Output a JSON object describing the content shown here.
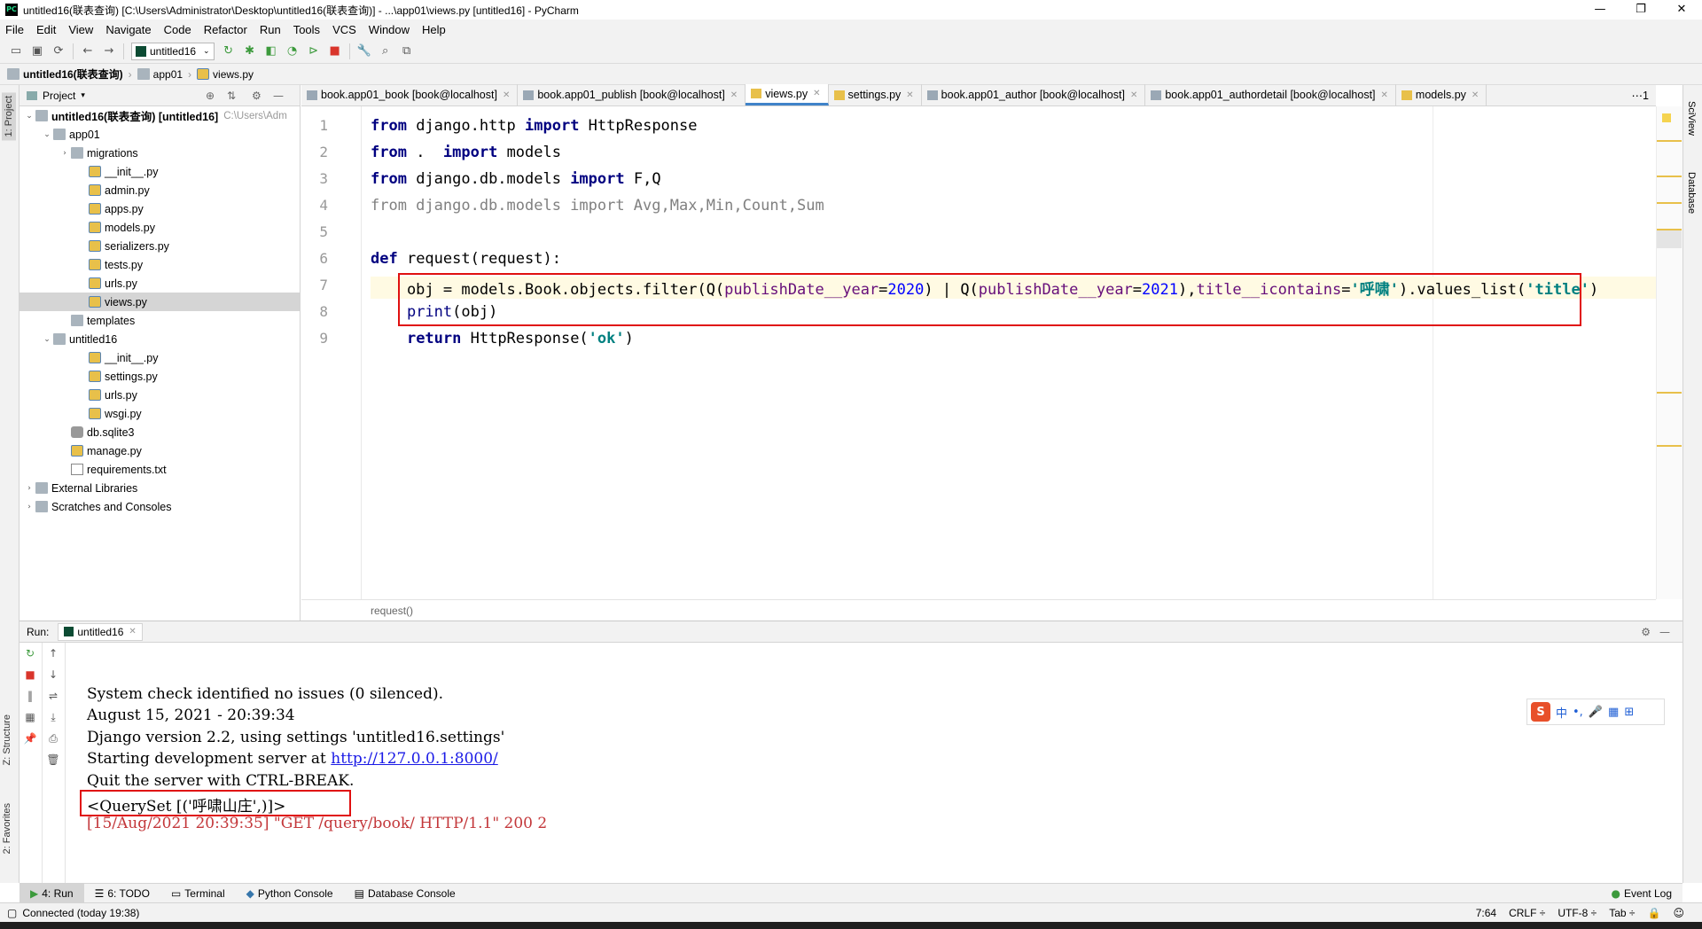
{
  "window": {
    "title": "untitled16(联表查询) [C:\\Users\\Administrator\\Desktop\\untitled16(联表查询)] - ...\\app01\\views.py [untitled16] - PyCharm",
    "logo": "PC",
    "min": "—",
    "max": "❐",
    "close": "✕"
  },
  "menu": [
    "File",
    "Edit",
    "View",
    "Navigate",
    "Code",
    "Refactor",
    "Run",
    "Tools",
    "VCS",
    "Window",
    "Help"
  ],
  "toolbar": {
    "run_config": "untitled16"
  },
  "navbar": {
    "project": "untitled16(联表查询)",
    "folder": "app01",
    "file": "views.py"
  },
  "left_strip": {
    "project": "1: Project",
    "structure": "Z: Structure",
    "favorites": "2: Favorites"
  },
  "right_strip": {
    "sciview": "SciView",
    "database": "Database"
  },
  "project_panel": {
    "title": "Project",
    "tree": [
      {
        "label": "untitled16(联表查询) [untitled16]",
        "extra": "C:\\Users\\Adm",
        "indent": 0,
        "arrow": "⌄",
        "icon": "folder",
        "bold": true
      },
      {
        "label": "app01",
        "indent": 1,
        "arrow": "⌄",
        "icon": "folder"
      },
      {
        "label": "migrations",
        "indent": 2,
        "arrow": "›",
        "icon": "folder"
      },
      {
        "label": "__init__.py",
        "indent": 3,
        "arrow": "",
        "icon": "py"
      },
      {
        "label": "admin.py",
        "indent": 3,
        "arrow": "",
        "icon": "py"
      },
      {
        "label": "apps.py",
        "indent": 3,
        "arrow": "",
        "icon": "py"
      },
      {
        "label": "models.py",
        "indent": 3,
        "arrow": "",
        "icon": "py"
      },
      {
        "label": "serializers.py",
        "indent": 3,
        "arrow": "",
        "icon": "py"
      },
      {
        "label": "tests.py",
        "indent": 3,
        "arrow": "",
        "icon": "py"
      },
      {
        "label": "urls.py",
        "indent": 3,
        "arrow": "",
        "icon": "py"
      },
      {
        "label": "views.py",
        "indent": 3,
        "arrow": "",
        "icon": "py",
        "selected": true
      },
      {
        "label": "templates",
        "indent": 2,
        "arrow": "",
        "icon": "folder"
      },
      {
        "label": "untitled16",
        "indent": 1,
        "arrow": "⌄",
        "icon": "folder"
      },
      {
        "label": "__init__.py",
        "indent": 3,
        "arrow": "",
        "icon": "py"
      },
      {
        "label": "settings.py",
        "indent": 3,
        "arrow": "",
        "icon": "py"
      },
      {
        "label": "urls.py",
        "indent": 3,
        "arrow": "",
        "icon": "py"
      },
      {
        "label": "wsgi.py",
        "indent": 3,
        "arrow": "",
        "icon": "py"
      },
      {
        "label": "db.sqlite3",
        "indent": 2,
        "arrow": "",
        "icon": "db"
      },
      {
        "label": "manage.py",
        "indent": 2,
        "arrow": "",
        "icon": "py"
      },
      {
        "label": "requirements.txt",
        "indent": 2,
        "arrow": "",
        "icon": "txt"
      },
      {
        "label": "External Libraries",
        "indent": 0,
        "arrow": "›",
        "icon": "lib"
      },
      {
        "label": "Scratches and Consoles",
        "indent": 0,
        "arrow": "›",
        "icon": "scratch"
      }
    ]
  },
  "tabs": [
    {
      "label": "book.app01_book [book@localhost]",
      "icon": "table"
    },
    {
      "label": "book.app01_publish [book@localhost]",
      "icon": "table"
    },
    {
      "label": "views.py",
      "icon": "py",
      "active": true
    },
    {
      "label": "settings.py",
      "icon": "py"
    },
    {
      "label": "book.app01_author [book@localhost]",
      "icon": "table"
    },
    {
      "label": "book.app01_authordetail [book@localhost]",
      "icon": "table"
    },
    {
      "label": "models.py",
      "icon": "py"
    }
  ],
  "tabs_overflow": "⋯1",
  "editor": {
    "line_numbers": [
      "1",
      "2",
      "3",
      "4",
      "5",
      "6",
      "7",
      "8",
      "9"
    ],
    "l1": {
      "a": "from",
      "b": " django.http ",
      "c": "import",
      "d": " HttpResponse"
    },
    "l2": {
      "a": "from",
      "b": " .  ",
      "c": "import",
      "d": " models"
    },
    "l3": {
      "a": "from",
      "b": " django.db.models ",
      "c": "import",
      "d": " F,Q"
    },
    "l4": "from django.db.models import Avg,Max,Min,Count,Sum",
    "l6": {
      "a": "def",
      "b": " request(",
      "c": "request",
      "d": "):"
    },
    "l7": {
      "a": "    obj = models.Book.objects.filter(Q(",
      "b": "publishDate__year",
      "c": "=",
      "d": "2020",
      "e": ") | Q(",
      "f": "publishDate__year",
      "g": "=",
      "h": "2021",
      "i": "),",
      "j": "title__icontains",
      "k": "=",
      "l": "'呼啸'",
      "m": ").values_list(",
      "n": "'title'",
      "o": ")"
    },
    "l8": {
      "a": "    ",
      "b": "print",
      "c": "(obj)"
    },
    "l9": {
      "a": "    ",
      "b": "return",
      "c": " HttpResponse(",
      "d": "'ok'",
      "e": ")"
    },
    "breadcrumb": "request()"
  },
  "run_panel": {
    "label": "Run:",
    "config": "untitled16",
    "lines": [
      "System check identified no issues (0 silenced).",
      "August 15, 2021 - 20:39:34",
      "Django version 2.2, using settings 'untitled16.settings'",
      "Starting development server at ",
      "Quit the server with CTRL-BREAK.",
      "<QuerySet [('呼啸山庄',)]>",
      "[15/Aug/2021 20:39:35] \"GET /query/book/ HTTP/1.1\" 200 2"
    ],
    "link": "http://127.0.0.1:8000/"
  },
  "ime": {
    "logo": "S",
    "lang": "中",
    "punct": "•,",
    "mic": "🎤",
    "kb": "▦",
    "grid": "⊞"
  },
  "bottom_tabs": [
    "4: Run",
    "6: TODO",
    "Terminal",
    "Python Console",
    "Database Console"
  ],
  "event_log": "Event Log",
  "status": {
    "left": "Connected (today 19:38)",
    "pos": "7:64",
    "crlf": "CRLF ÷",
    "enc": "UTF-8 ÷",
    "tab": "Tab ÷"
  },
  "colors": {
    "accent": "#4083c9",
    "red_box": "#e01010",
    "keyword": "#000080",
    "string": "#008080",
    "param": "#660e7a"
  }
}
